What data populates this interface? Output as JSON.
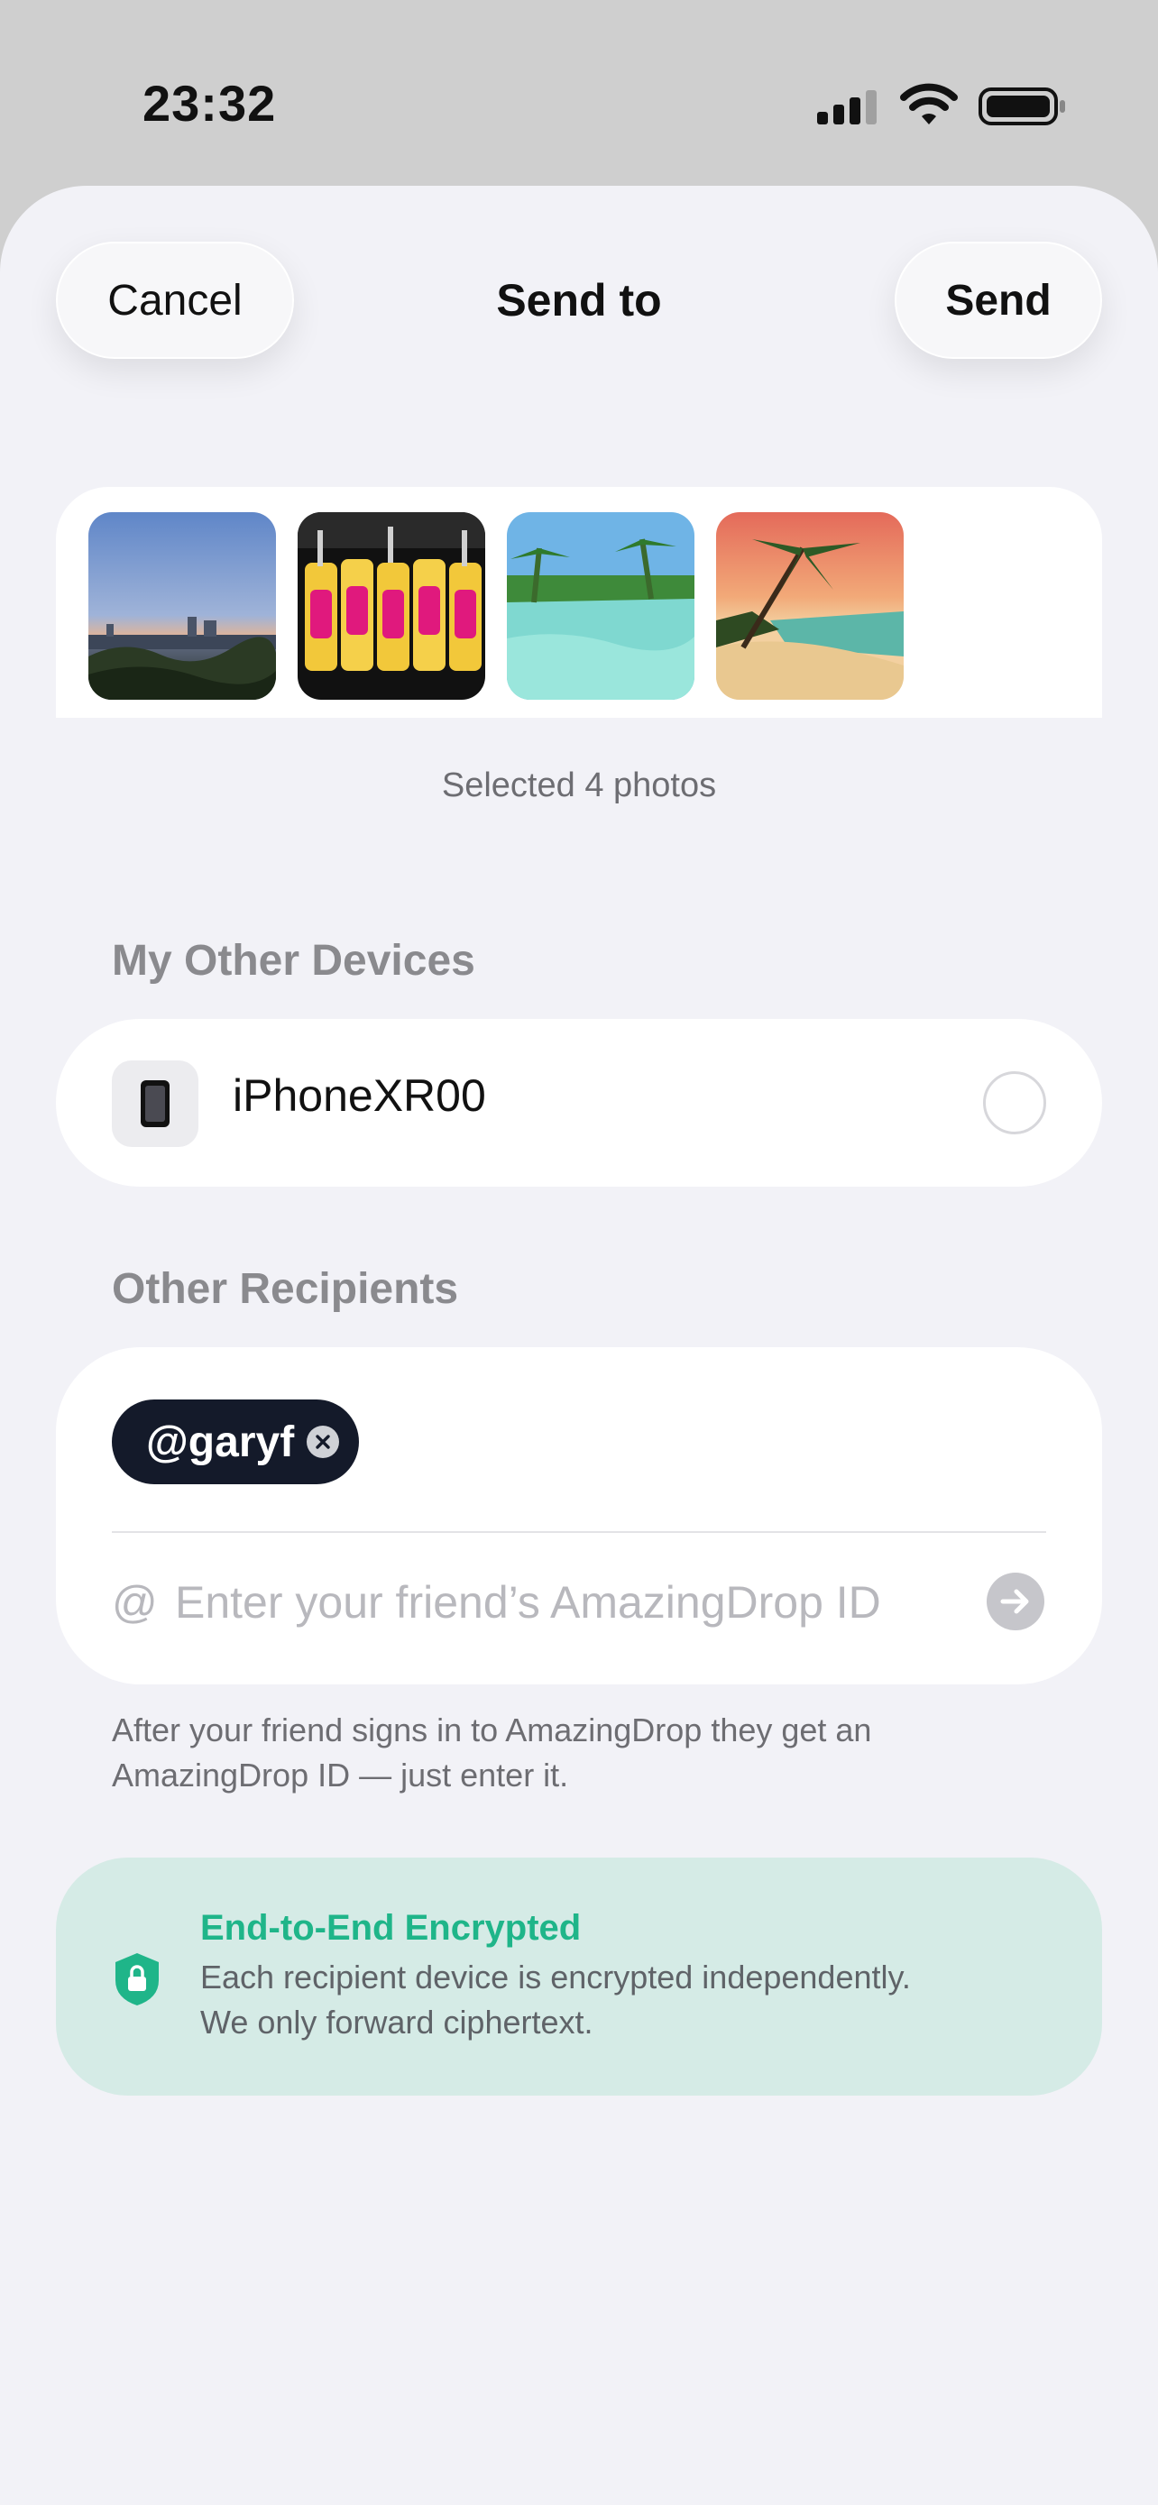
{
  "status_bar": {
    "time": "23:32"
  },
  "nav": {
    "cancel_label": "Cancel",
    "title": "Send to",
    "send_label": "Send"
  },
  "photos": {
    "items": [
      {
        "name": "city-dusk-photo"
      },
      {
        "name": "neon-cans-photo"
      },
      {
        "name": "tropical-lagoon-photo"
      },
      {
        "name": "palm-beach-sunset-photo"
      }
    ],
    "selected_label": "Selected 4 photos"
  },
  "my_devices": {
    "title": "My Other Devices",
    "items": [
      {
        "name": "iPhoneXR00",
        "selected": false,
        "icon": "phone-icon"
      }
    ]
  },
  "recipients": {
    "title": "Other Recipients",
    "chips": [
      {
        "label": "@garyf"
      }
    ],
    "at_symbol": "@",
    "input_value": "",
    "input_placeholder": "Enter your friend’s AmazingDrop ID",
    "helper_text": "After your friend signs in to AmazingDrop they get an AmazingDrop ID — just enter it."
  },
  "encryption": {
    "title": "End-to-End Encrypted",
    "line1": "Each recipient device is encrypted independently.",
    "line2": "We only forward ciphertext.",
    "accent": "#1fb589"
  },
  "colors": {
    "sheet_bg": "#f2f2f7",
    "chip_bg": "#141a2a",
    "encryption_bg": "#d5ebe6"
  }
}
